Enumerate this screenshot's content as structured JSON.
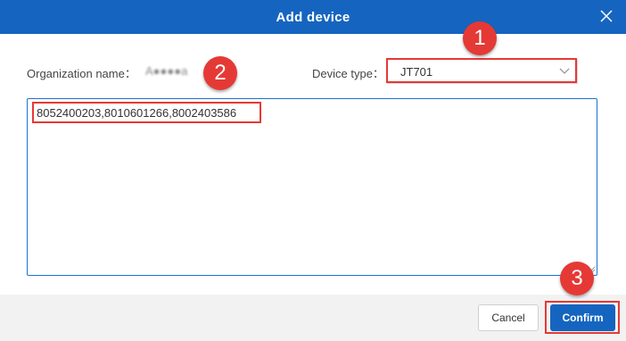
{
  "dialog": {
    "title": "Add device",
    "close_icon": "close-icon"
  },
  "form": {
    "org_label": "Organization name：",
    "org_value": "A●●●●a",
    "device_type_label": "Device type：",
    "device_type_value": "JT701",
    "device_type_icon": "chevron-down-icon",
    "device_ids": "8052400203,8010601266,8002403586"
  },
  "buttons": {
    "cancel": "Cancel",
    "confirm": "Confirm"
  },
  "annotations": {
    "badge_1": "1",
    "badge_2": "2",
    "badge_3": "3"
  },
  "colors": {
    "accent": "#1565c0",
    "highlight": "#e53935",
    "footer": "#f2f2f2"
  }
}
